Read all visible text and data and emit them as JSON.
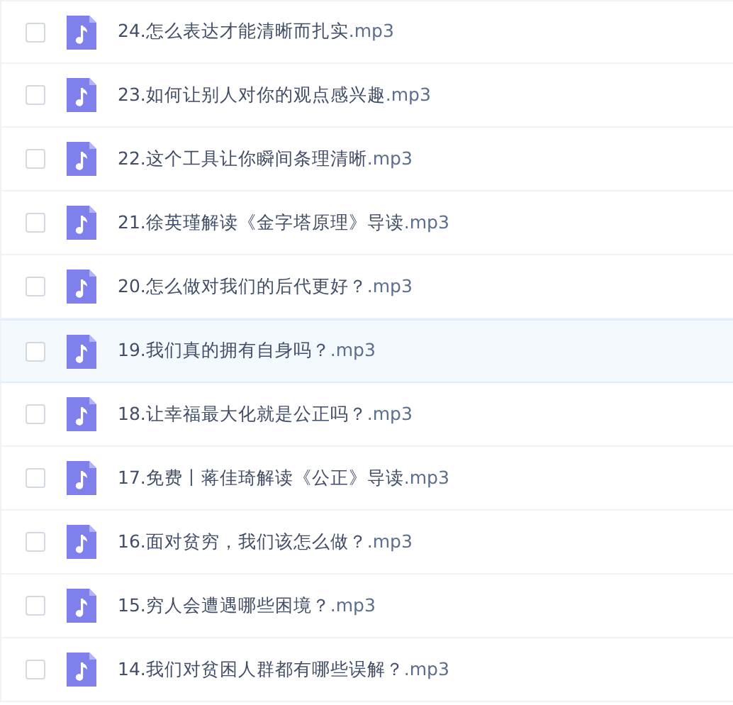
{
  "files": [
    {
      "name": "24.怎么表达才能清晰而扎实",
      "extension": ".mp3",
      "checked": false,
      "hovered": false
    },
    {
      "name": "23.如何让别人对你的观点感兴趣",
      "extension": ".mp3",
      "checked": false,
      "hovered": false
    },
    {
      "name": "22.这个工具让你瞬间条理清晰",
      "extension": ".mp3",
      "checked": false,
      "hovered": false
    },
    {
      "name": "21.徐英瑾解读《金字塔原理》导读",
      "extension": ".mp3",
      "checked": false,
      "hovered": false
    },
    {
      "name": "20.怎么做对我们的后代更好？",
      "extension": ".mp3",
      "checked": false,
      "hovered": false
    },
    {
      "name": "19.我们真的拥有自身吗？",
      "extension": ".mp3",
      "checked": false,
      "hovered": true
    },
    {
      "name": "18.让幸福最大化就是公正吗？",
      "extension": ".mp3",
      "checked": false,
      "hovered": false
    },
    {
      "name": "17.免费丨蒋佳琦解读《公正》导读",
      "extension": ".mp3",
      "checked": false,
      "hovered": false
    },
    {
      "name": "16.面对贫穷，我们该怎么做？",
      "extension": ".mp3",
      "checked": false,
      "hovered": false
    },
    {
      "name": "15.穷人会遭遇哪些困境？",
      "extension": ".mp3",
      "checked": false,
      "hovered": false
    },
    {
      "name": "14.我们对贫困人群都有哪些误解？",
      "extension": ".mp3",
      "checked": false,
      "hovered": false
    }
  ]
}
